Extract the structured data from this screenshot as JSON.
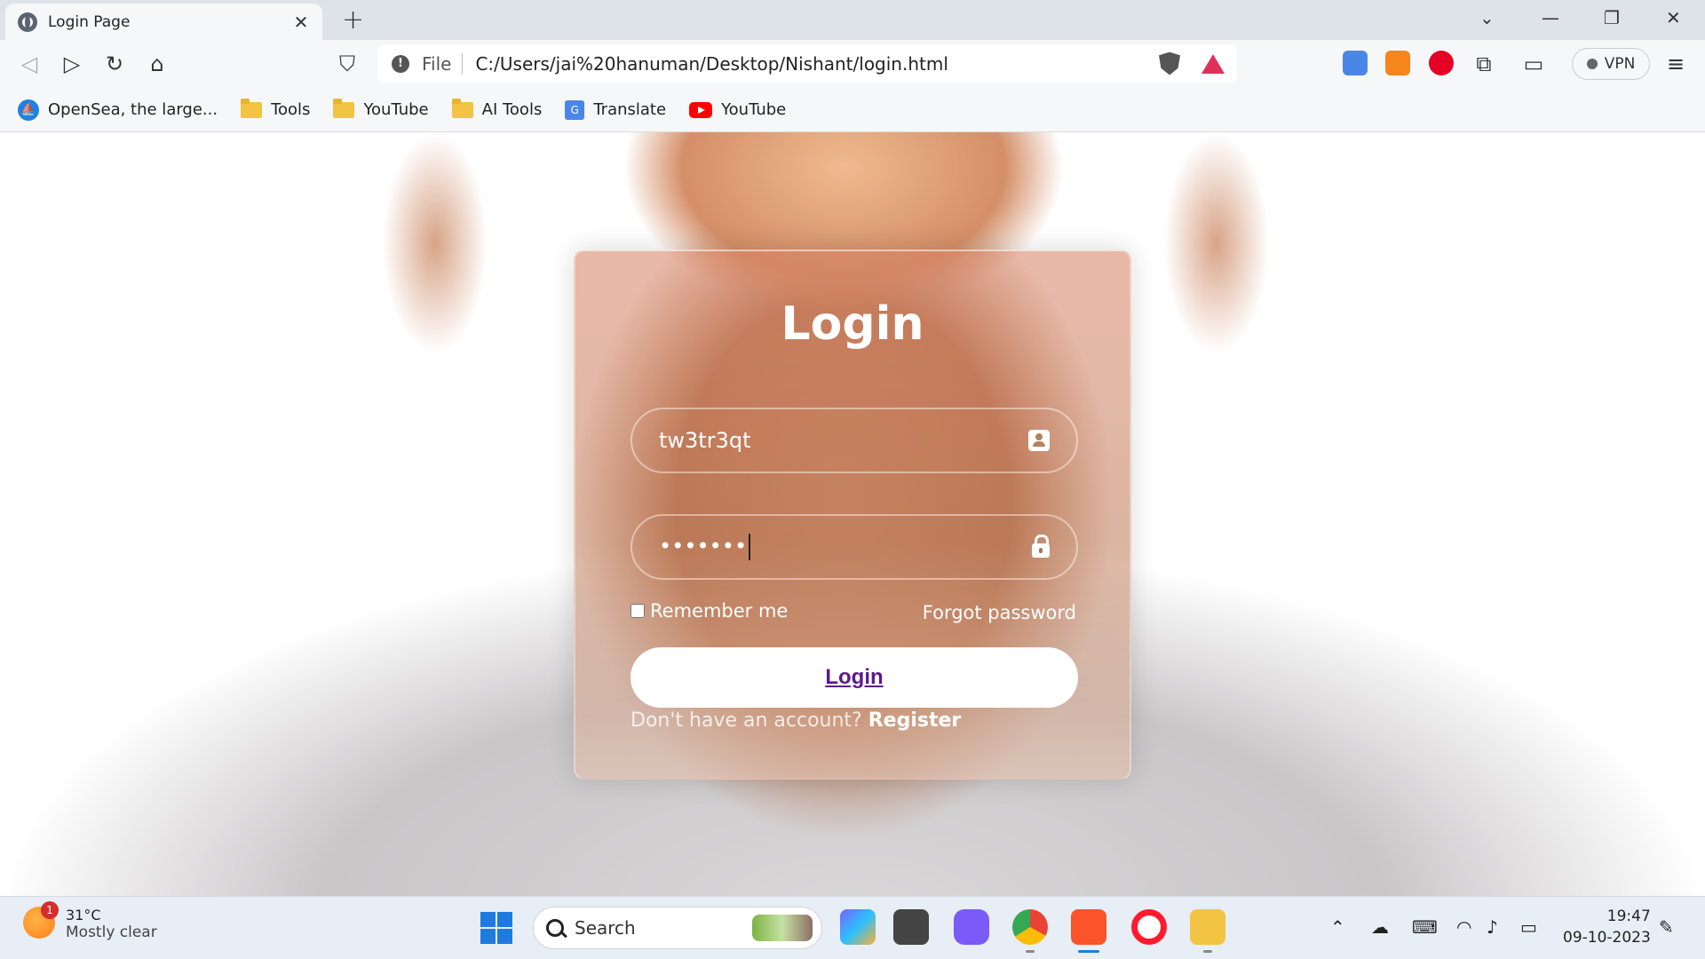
{
  "browser": {
    "tab_title": "Login Page",
    "tab_close": "✕",
    "new_tab": "+",
    "controls": {
      "tab_list": "⌄",
      "minimize": "—",
      "restore": "❐",
      "close": "✕"
    },
    "address": {
      "scheme": "File",
      "url": "C:/Users/jai%20hanuman/Desktop/Nishant/login.html"
    },
    "vpn_label": "VPN",
    "bookmarks": [
      {
        "label": "OpenSea, the large...",
        "icon": "opensea-icon"
      },
      {
        "label": "Tools",
        "icon": "folder-icon"
      },
      {
        "label": "YouTube",
        "icon": "folder-icon"
      },
      {
        "label": "AI Tools",
        "icon": "folder-icon"
      },
      {
        "label": "Translate",
        "icon": "google-translate-icon"
      },
      {
        "label": "YouTube",
        "icon": "youtube-icon"
      }
    ]
  },
  "login": {
    "title": "Login",
    "username_value": "tw3tr3qt",
    "password_value": "•••••••",
    "remember_label": "Remember me",
    "forgot_label": "Forgot password",
    "button_label": "Login",
    "signup_prompt": "Don't have an account?",
    "signup_link": "Register"
  },
  "taskbar": {
    "weather": {
      "badge": "1",
      "temp": "31°C",
      "desc": "Mostly clear"
    },
    "search_label": "Search",
    "clock": {
      "time": "19:47",
      "date": "09-10-2023"
    }
  },
  "colors": {
    "button_text": "#5b1a8c",
    "brave_red": "#e0315a",
    "windows_blue": "#1f7ae0"
  }
}
